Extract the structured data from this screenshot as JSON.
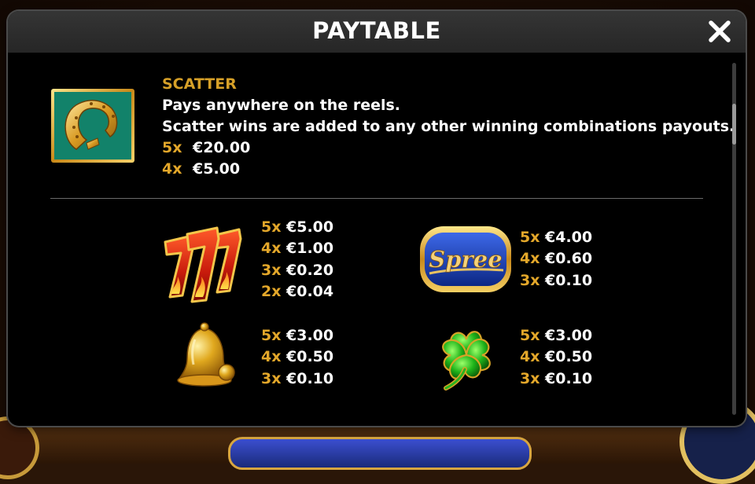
{
  "colors": {
    "accent": "#e3a72a",
    "title_gold": "#d6a028",
    "header_bg": "#2e2e2e",
    "panel_bg": "#000000"
  },
  "modal": {
    "title": "PAYTABLE",
    "close_icon": "close-icon"
  },
  "scatter": {
    "icon": "horseshoe-icon",
    "title": "SCATTER",
    "line1": "Pays anywhere on the reels.",
    "line2": "Scatter wins are added to any other winning combinations payouts.",
    "pays": [
      {
        "mult": "5x",
        "amount": "€20.00"
      },
      {
        "mult": "4x",
        "amount": "€5.00"
      }
    ]
  },
  "symbols": [
    {
      "icon": "triple-seven-icon",
      "pays": [
        {
          "mult": "5x",
          "amount": "€5.00"
        },
        {
          "mult": "4x",
          "amount": "€1.00"
        },
        {
          "mult": "3x",
          "amount": "€0.20"
        },
        {
          "mult": "2x",
          "amount": "€0.04"
        }
      ]
    },
    {
      "icon": "spree-logo-icon",
      "logo_text": "Spree",
      "pays": [
        {
          "mult": "5x",
          "amount": "€4.00"
        },
        {
          "mult": "4x",
          "amount": "€0.60"
        },
        {
          "mult": "3x",
          "amount": "€0.10"
        }
      ]
    },
    {
      "icon": "bell-icon",
      "pays": [
        {
          "mult": "5x",
          "amount": "€3.00"
        },
        {
          "mult": "4x",
          "amount": "€0.50"
        },
        {
          "mult": "3x",
          "amount": "€0.10"
        }
      ]
    },
    {
      "icon": "clover-icon",
      "pays": [
        {
          "mult": "5x",
          "amount": "€3.00"
        },
        {
          "mult": "4x",
          "amount": "€0.50"
        },
        {
          "mult": "3x",
          "amount": "€0.10"
        }
      ]
    }
  ]
}
